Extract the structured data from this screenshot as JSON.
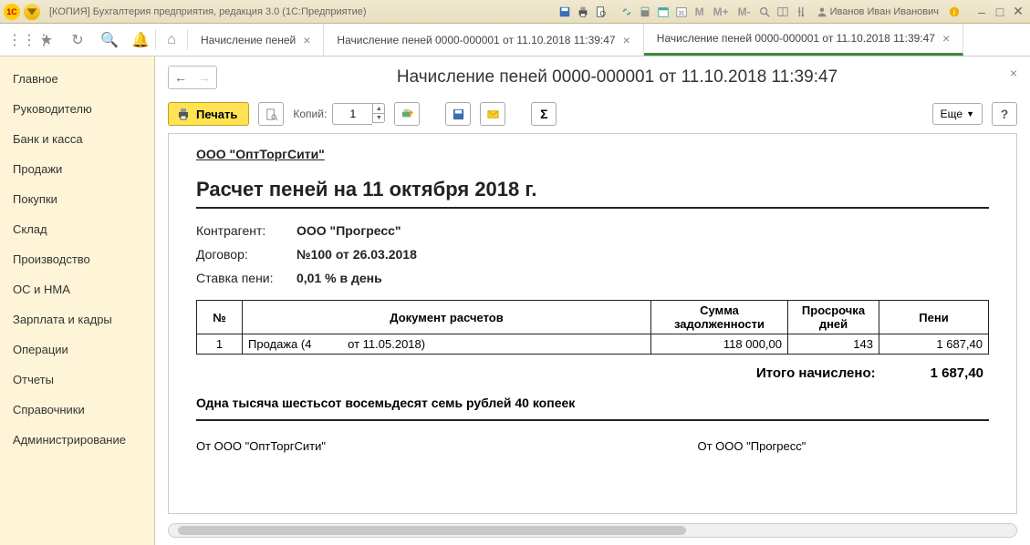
{
  "titlebar": {
    "title": "[КОПИЯ] Бухгалтерия предприятия, редакция 3.0  (1С:Предприятие)",
    "user": "Иванов Иван Иванович",
    "m": "M",
    "mplus": "M+",
    "mminus": "M-"
  },
  "tabs": [
    {
      "label": "Начисление пеней",
      "active": false
    },
    {
      "label": "Начисление пеней 0000-000001 от 11.10.2018 11:39:47",
      "active": false
    },
    {
      "label": "Начисление пеней 0000-000001 от 11.10.2018 11:39:47",
      "active": true
    }
  ],
  "sidebar": {
    "items": [
      "Главное",
      "Руководителю",
      "Банк и касса",
      "Продажи",
      "Покупки",
      "Склад",
      "Производство",
      "ОС и НМА",
      "Зарплата и кадры",
      "Операции",
      "Отчеты",
      "Справочники",
      "Администрирование"
    ]
  },
  "content": {
    "title": "Начисление пеней 0000-000001 от 11.10.2018 11:39:47"
  },
  "toolbar": {
    "print_label": "Печать",
    "copies_label": "Копий:",
    "copies_value": "1",
    "more_label": "Еще"
  },
  "doc": {
    "org": "ООО \"ОптТоргСити\"",
    "title": "Расчет пеней на 11 октября 2018 г.",
    "rows": {
      "counterparty_label": "Контрагент:",
      "counterparty_value": "ООО \"Прогресс\"",
      "contract_label": "Договор:",
      "contract_value": "№100 от 26.03.2018",
      "rate_label": "Ставка пени:",
      "rate_value": "0,01 % в день"
    },
    "table": {
      "headers": [
        "№",
        "Документ расчетов",
        "Сумма задолженности",
        "Просрочка дней",
        "Пени"
      ],
      "row": {
        "num": "1",
        "doc": "Продажа (4           от 11.05.2018)",
        "sum": "118 000,00",
        "days": "143",
        "peni": "1 687,40"
      }
    },
    "total_label": "Итого начислено:",
    "total_value": "1 687,40",
    "words": "Одна тысяча шестьсот восемьдесят семь рублей 40 копеек",
    "sign_from": "От ООО \"ОптТоргСити\"",
    "sign_to": "От ООО \"Прогресс\""
  }
}
